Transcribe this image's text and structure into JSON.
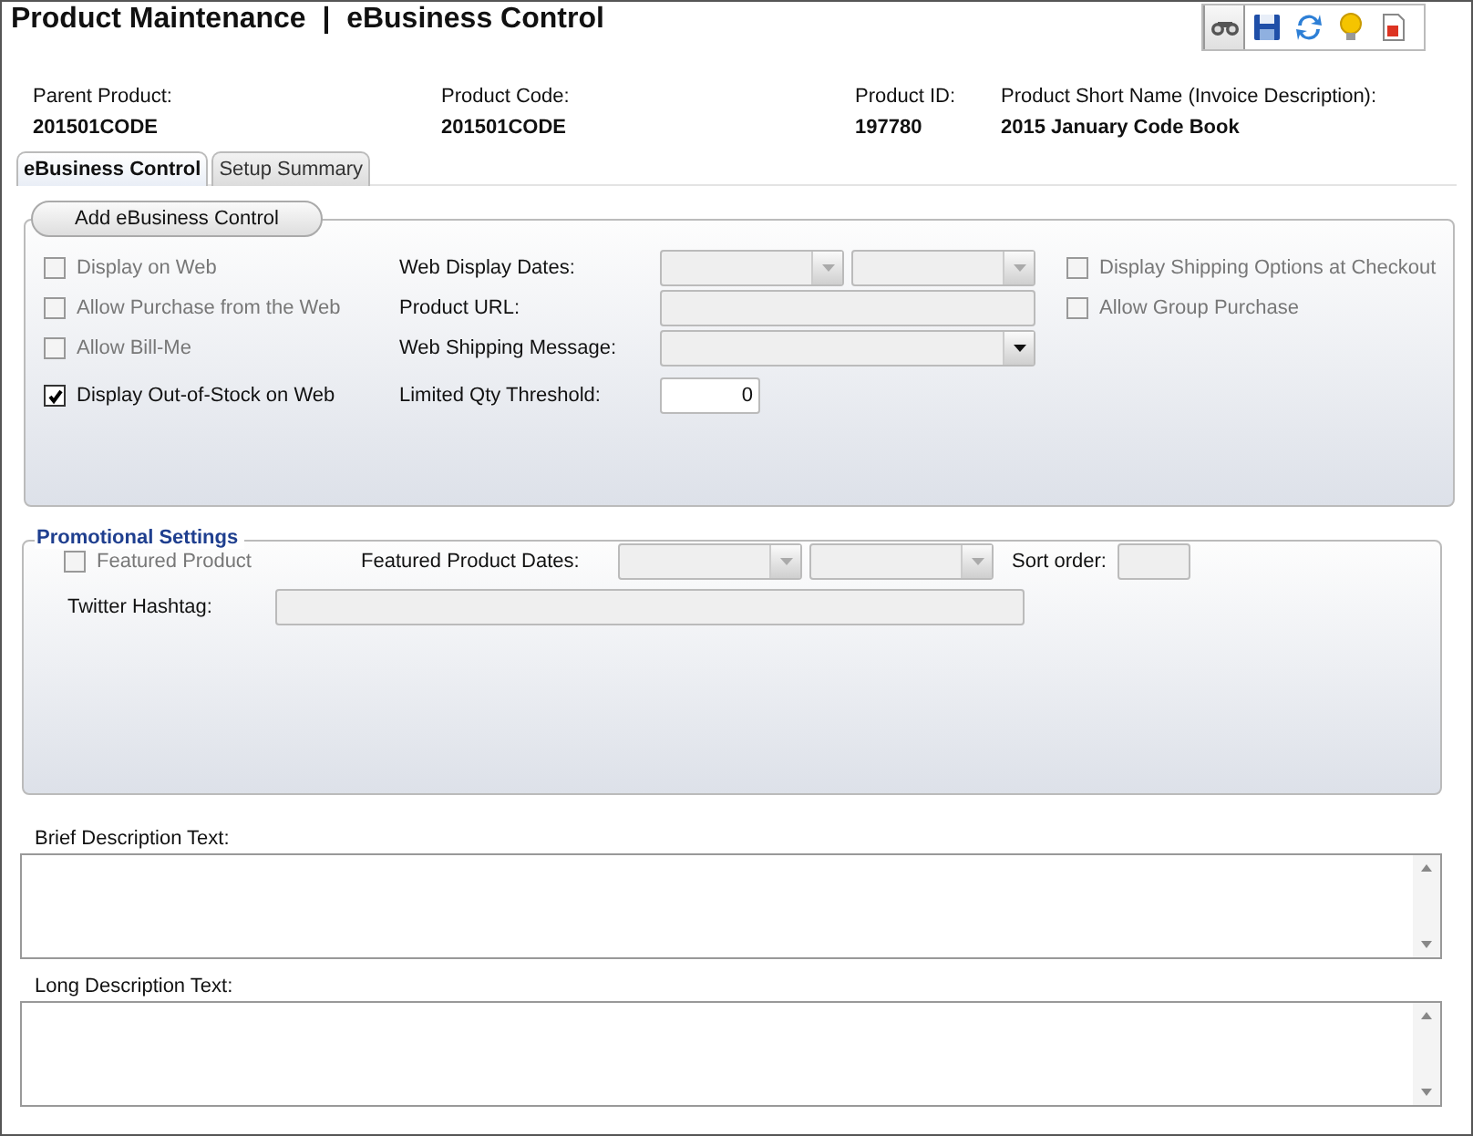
{
  "window": {
    "title": "Product Maintenance  |  eBusiness Control"
  },
  "toolbar": [
    {
      "kind": "find",
      "selected": true
    },
    {
      "kind": "save",
      "selected": false
    },
    {
      "kind": "refresh",
      "selected": false
    },
    {
      "kind": "tip",
      "selected": false
    },
    {
      "kind": "report",
      "selected": false
    }
  ],
  "product_info": [
    {
      "label": "Parent Product:",
      "value": "201501CODE"
    },
    {
      "label": "Product Code:",
      "value": "201501CODE"
    },
    {
      "label": "Product ID:",
      "value": "197780"
    },
    {
      "label": "Product Short Name (Invoice Description):",
      "value": "2015 January Code Book"
    }
  ],
  "tabs": [
    {
      "label": "eBusiness Control",
      "selected": true
    },
    {
      "label": "Setup Summary",
      "selected": false
    }
  ],
  "ebusiness": {
    "button": "Add eBusiness Control",
    "checkboxes": [
      {
        "label": "Display on Web",
        "checked": false,
        "disabled": true
      },
      {
        "label": "Allow Purchase from the Web",
        "checked": false,
        "disabled": true
      },
      {
        "label": "Allow Bill-Me",
        "checked": false,
        "disabled": true
      },
      {
        "label": "Display Out-of-Stock on Web",
        "checked": true,
        "disabled": false
      }
    ],
    "fields": [
      {
        "label": "Web Display Dates:",
        "inputs": [
          {
            "kind": "select",
            "disabled": true
          },
          {
            "kind": "select",
            "disabled": true
          }
        ]
      },
      {
        "label": "Product URL:",
        "inputs": [
          {
            "kind": "text",
            "disabled": true
          }
        ]
      },
      {
        "label": "Web Shipping Message:",
        "inputs": [
          {
            "kind": "select",
            "disabled": false
          }
        ]
      },
      {
        "label": "Limited Qty Threshold:",
        "inputs": [
          {
            "kind": "number",
            "disabled": false,
            "value": "0"
          }
        ]
      }
    ],
    "options": [
      {
        "label": "Display Shipping Options at Checkout",
        "checked": false,
        "disabled": true
      },
      {
        "label": "Allow Group Purchase",
        "checked": false,
        "disabled": true
      }
    ]
  },
  "promotional_settings": {
    "title": "Promotional Settings",
    "featured": {
      "label": "Featured Product",
      "checked": false,
      "disabled": true
    },
    "dates_label": "Featured Product Dates:",
    "dates": [
      {
        "kind": "select",
        "disabled": true
      },
      {
        "kind": "select",
        "disabled": true
      }
    ],
    "sort_label": "Sort order:",
    "sort": {
      "kind": "text",
      "disabled": true
    },
    "hashtag_label": "Twitter Hashtag:",
    "hashtag": {
      "kind": "text",
      "disabled": true
    }
  },
  "descriptions": [
    {
      "label": "Brief Description Text:"
    },
    {
      "label": "Long Description Text:"
    }
  ]
}
